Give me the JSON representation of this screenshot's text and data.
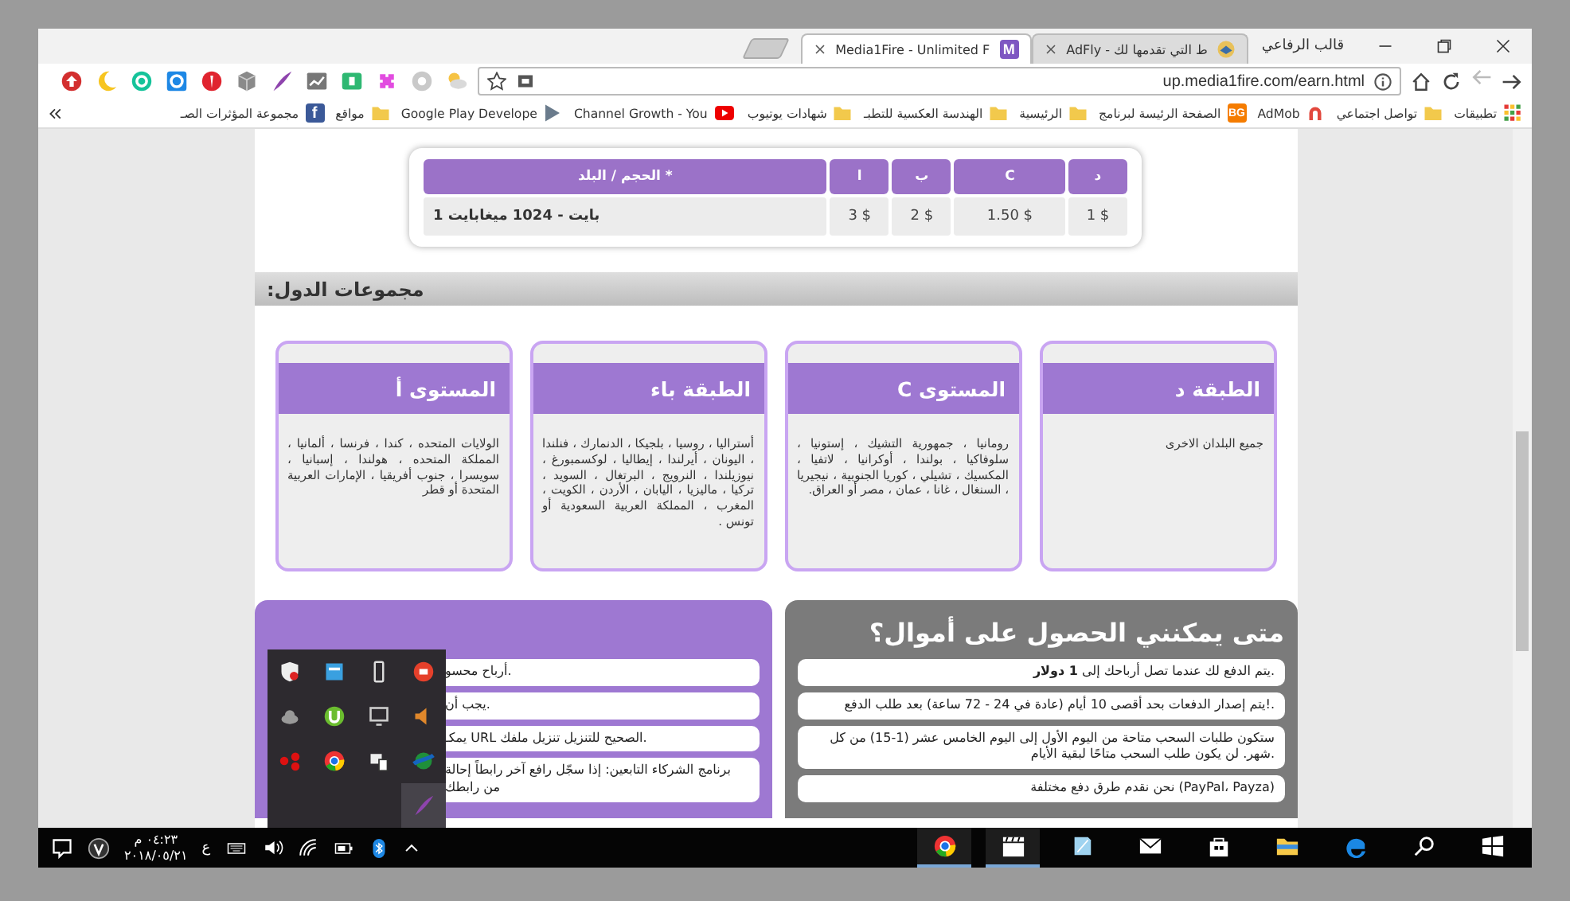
{
  "browser": {
    "profile_name": "قالب الرفاعي",
    "tabs": [
      {
        "title": "ط التي تقدمها لك - AdFly",
        "selected": false,
        "kind": "adfly"
      },
      {
        "title": "Media1Fire - Unlimited F",
        "selected": true,
        "kind": "letter",
        "favicon_text": "M"
      }
    ],
    "forward": {
      "disabled": true
    },
    "url": "up.media1fire.com/earn.html",
    "bookmarks": [
      {
        "kind": "apps",
        "label": "تطبيقات"
      },
      {
        "kind": "folder",
        "label": "تواصل اجتماعي"
      },
      {
        "kind": "admob",
        "label": "AdMob"
      },
      {
        "kind": "badge",
        "icon_text": "BG",
        "label": "الصفحة الرئيسة لبرنامج"
      },
      {
        "kind": "folder",
        "label": "الرئيسية"
      },
      {
        "kind": "folder",
        "label": "الهندسة العكسية للتطبـ"
      },
      {
        "kind": "folder",
        "label": "شهادات يوتيوب"
      },
      {
        "kind": "youtube",
        "label": "Channel Growth - You"
      },
      {
        "kind": "channel",
        "label": "Google Play Develope"
      },
      {
        "kind": "folder",
        "label": "مواقع"
      },
      {
        "kind": "facebook",
        "icon_text": "f",
        "label": "مجموعة المؤثرات الصـ"
      }
    ]
  },
  "page": {
    "rates_table": {
      "columns": [
        "د",
        "C",
        "ب",
        "ا",
        "* الحجم / البلد"
      ],
      "rows": [
        {
          "cells": [
            "$ 1",
            "$ 1.50",
            "$ 2",
            "$ 3",
            "بايت - 1024 ميغابايت 1"
          ]
        }
      ]
    },
    "section_title": "مجموعات الدول:",
    "tiers": [
      {
        "title": "الطبقة د",
        "countries": "جميع البلدان الاخرى"
      },
      {
        "title": "المستوى C",
        "countries": "رومانيا ، جمهورية التشيك ، إستونيا ، سلوفاكيا ، بولندا ، أوكرانيا ، لاتفيا ، المكسيك ، تشيلي ، كوريا الجنوبية ، نيجيريا ، السنغال ، غانا ، عمان ، مصر أو العراق."
      },
      {
        "title": "الطبقة باء",
        "countries": "أستراليا ، روسيا ، بلجيكا ، الدنمارك ، فنلندا ، اليونان ، أيرلندا ، إيطاليا ، لوكسمبورغ ، نيوزيلندا ، النرويج ، البرتغال ، السويد ، تركيا ، ماليزيا ، اليابان ، الأردن ، الكويت ، المغرب ، المملكة العربية السعودية أو تونس ."
      },
      {
        "title": "المستوى أ",
        "countries": "الولايات المتحده ، كندا ، فرنسا ، ألمانيا ، المملكة المتحده ، هولندا ، إسبانيا ، سويسرا ، جنوب أفريقيا ، الإمارات العربية المتحدة أو قطر"
      }
    ],
    "payout_panel": {
      "title": "متى يمكنني الحصول على أموال؟",
      "items": [
        "يتم الدفع لك عندما تصل أرباحك إلى **1 دولار**.",
        "يتم إصدار الدفعات بحد أقصى 10 أيام (عادة في 24 - 72 ساعة) بعد طلب الدفع!.",
        "ستكون طلبات السحب متاحة من اليوم الأول إلى اليوم الخامس عشر (1-15) من كل شهر. لن يكون طلب السحب متاحًا لبقية الأيام.",
        "نحن نقدم طرق دفع مختلفة (PayPal، Payza)"
      ]
    },
    "info_panel": {
      "items": [
        "أرباح محسو.",
        "يجب أن.",
        "يمكـ URL الصحيح للتنزيل تنزيل ملفك.",
        "برنامج الشركاء التابعين: إذا سجّل رافع آخر رابطاً إحالة من رابطك"
      ]
    }
  },
  "taskbar": {
    "time": "٠٤:٢٣ م",
    "date": "٢٠١٨/٠٥/٢١",
    "language": "ع",
    "apps": [
      {
        "kind": "chrome",
        "running": true
      },
      {
        "kind": "clapper",
        "running": true
      },
      {
        "kind": "notes",
        "running": false
      },
      {
        "kind": "mail",
        "running": false
      },
      {
        "kind": "store",
        "running": false
      },
      {
        "kind": "explorer",
        "running": false
      },
      {
        "kind": "edge",
        "running": false
      },
      {
        "kind": "search",
        "running": false
      },
      {
        "kind": "start",
        "running": false
      }
    ]
  }
}
